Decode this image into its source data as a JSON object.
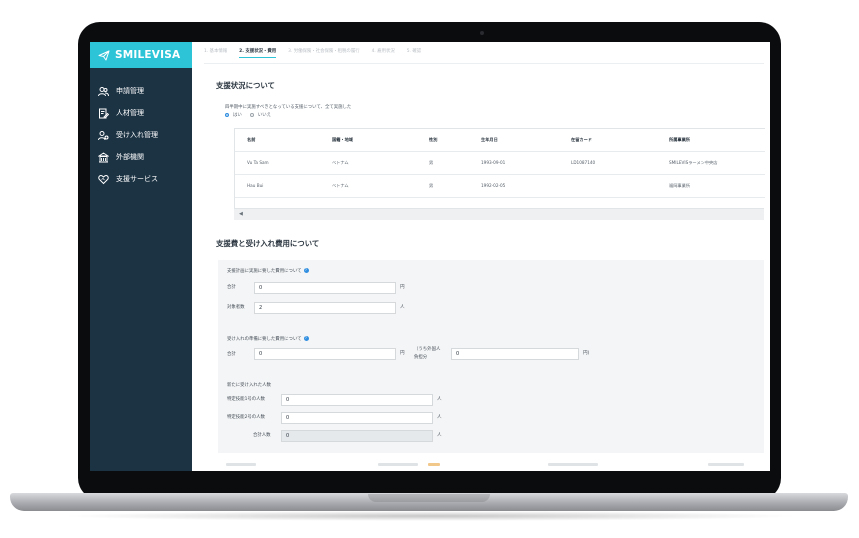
{
  "app": {
    "name": "SMILEVISA",
    "brand_color": "#2ec4d8",
    "sidebar_color": "#1c3344"
  },
  "sidebar": {
    "items": [
      {
        "label": "申請管理",
        "icon": "people-icon"
      },
      {
        "label": "人材管理",
        "icon": "document-edit-icon"
      },
      {
        "label": "受け入れ管理",
        "icon": "user-add-icon"
      },
      {
        "label": "外部機関",
        "icon": "building-icon"
      },
      {
        "label": "支援サービス",
        "icon": "heart-handshake-icon"
      }
    ]
  },
  "steps": [
    {
      "label": "1. 基本情報",
      "active": false
    },
    {
      "label": "2. 支援状況・費用",
      "active": true
    },
    {
      "label": "3. 労働保険・社会保険・租税の履行",
      "active": false
    },
    {
      "label": "4. 雇用状況",
      "active": false
    },
    {
      "label": "5. 確認",
      "active": false
    }
  ],
  "support_status": {
    "title": "支援状況について",
    "question": "四半期中に実施すべきとなっている支援について、全て実施した",
    "options": [
      {
        "label": "はい",
        "selected": true
      },
      {
        "label": "いいえ",
        "selected": false
      }
    ],
    "table": {
      "headers": [
        "名前",
        "国籍・地域",
        "性別",
        "生年月日",
        "在留カード",
        "所属事業所"
      ],
      "rows": [
        [
          "Vu Ta Sam",
          "ベトナム",
          "男",
          "1993-09-01",
          "LD1087140",
          "SMILEVISラーメン中央店"
        ],
        [
          "Hau Bui",
          "ベトナム",
          "男",
          "1992-02-05",
          "",
          "福岡事業所"
        ]
      ]
    },
    "scroll_icon": "◀"
  },
  "costs": {
    "title": "支援費と受け入れ費用について",
    "support_cost": {
      "label": "支援計画に実施に要した費用について",
      "total_label": "合計",
      "total_value": "0",
      "total_unit": "円",
      "count_label": "対象者数",
      "count_value": "2",
      "count_unit": "人"
    },
    "acceptance_cost": {
      "label": "受け入れの準備に要した費用について",
      "total_label": "合計",
      "total_value": "0",
      "total_unit": "円",
      "foreign_label_1": "（うち外国人",
      "foreign_label_2": "負担分",
      "foreign_value": "0",
      "foreign_unit": "円)"
    },
    "new_accepted": {
      "label": "新たに受け入れた人数",
      "rows": [
        {
          "label": "特定技能1号の人数",
          "value": "0",
          "unit": "人",
          "readonly": false
        },
        {
          "label": "特定技能2号の人数",
          "value": "0",
          "unit": "人",
          "readonly": false
        },
        {
          "label": "合計人数",
          "value": "0",
          "unit": "人",
          "readonly": true
        }
      ]
    }
  }
}
